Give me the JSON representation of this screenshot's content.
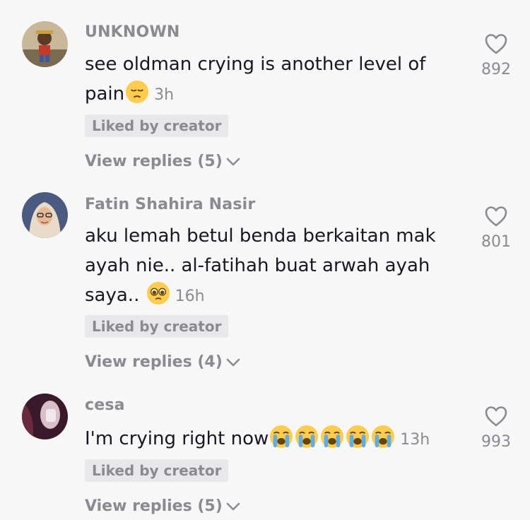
{
  "comments": [
    {
      "username": "UNKNOWN",
      "text": "see oldman crying is another level of pain",
      "emoji": "pensive-face",
      "time": "3h",
      "liked_label": "Liked by creator",
      "replies_label": "View replies (5)",
      "likes": "892"
    },
    {
      "username": "Fatin Shahira Nasir",
      "text": "aku lemah betul benda berkaitan mak ayah nie.. al-fatihah buat arwah ayah saya..",
      "emoji": "pleading-face",
      "time": "16h",
      "liked_label": "Liked by creator",
      "replies_label": "View replies (4)",
      "likes": "801"
    },
    {
      "username": "cesa",
      "text": "I'm crying right now",
      "emoji": "loudly-crying-face x5",
      "time": "13h",
      "liked_label": "Liked by creator",
      "replies_label": "View replies (5)",
      "likes": "993"
    }
  ],
  "colors": {
    "background": "#f7f7f7",
    "muted_text": "#8a8b91",
    "primary_text": "#161823",
    "badge_bg": "#e8e8ea"
  }
}
